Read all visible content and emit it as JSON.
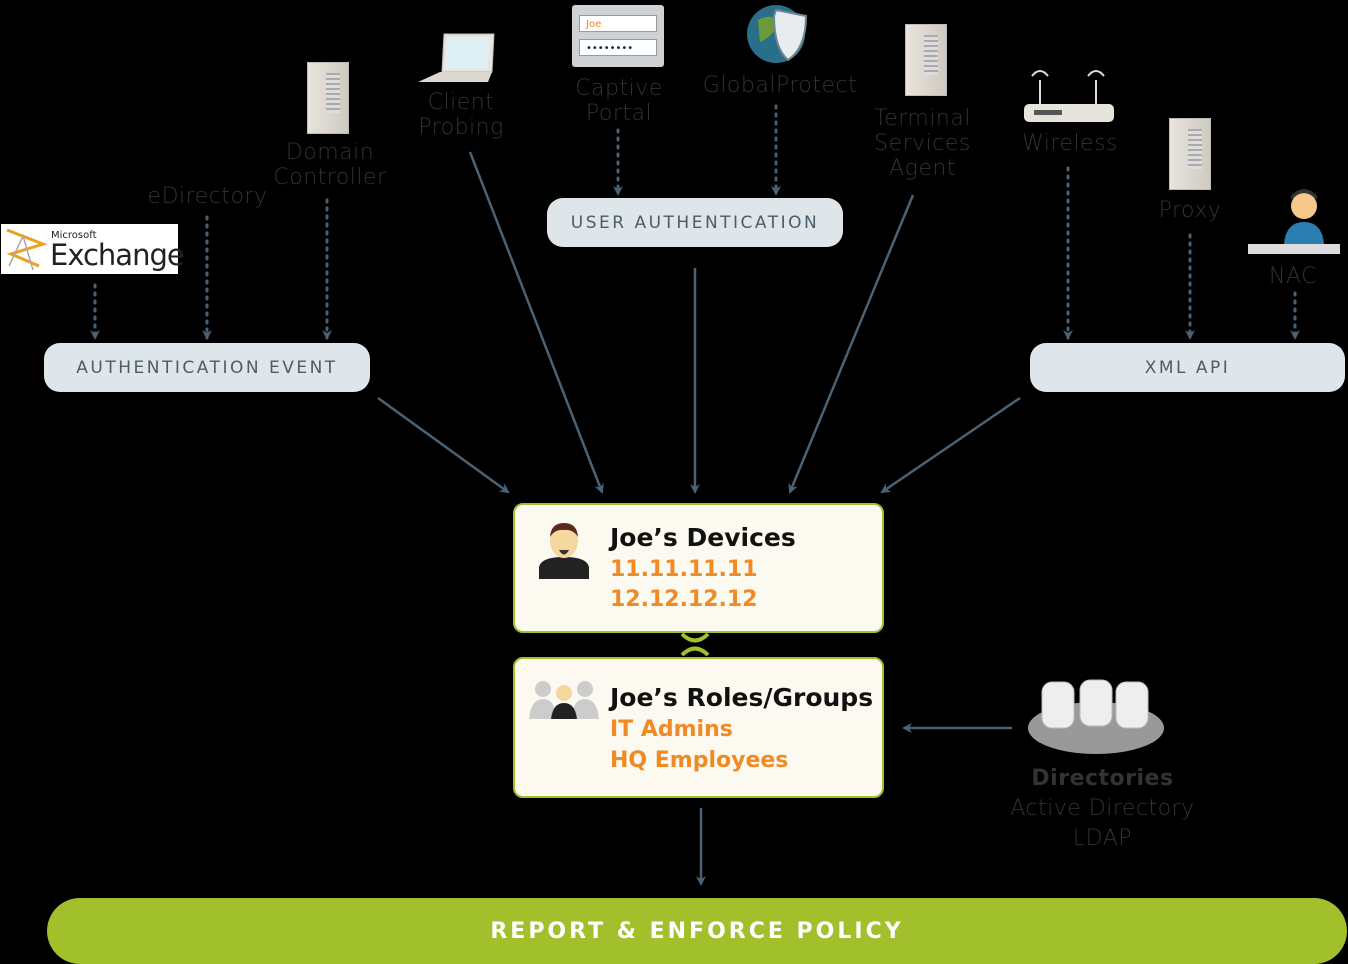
{
  "sources": {
    "exchange": {
      "small": "Microsoft",
      "big": "Exchange"
    },
    "edirectory": "eDirectory",
    "domain_controller": [
      "Domain",
      "Controller"
    ],
    "client_probing": [
      "Client",
      "Probing"
    ],
    "captive_portal": {
      "label": [
        "Captive",
        "Portal"
      ],
      "username": "Joe",
      "password": "••••••••"
    },
    "globalprotect": "GlobalProtect",
    "terminal_services": [
      "Terminal",
      "Services",
      "Agent"
    ],
    "wireless": "Wireless",
    "proxy": "Proxy",
    "nac": "NAC"
  },
  "collectors": {
    "authentication_event": "AUTHENTICATION EVENT",
    "user_authentication": "USER AUTHENTICATION",
    "xml_api": "XML API"
  },
  "devices": {
    "title": "Joe’s Devices",
    "items": [
      "11.11.11.11",
      "12.12.12.12"
    ]
  },
  "roles": {
    "title": "Joe’s Roles/Groups",
    "items": [
      "IT Admins",
      "HQ Employees"
    ]
  },
  "directories": {
    "title": "Directories",
    "items": [
      "Active Directory",
      "LDAP"
    ]
  },
  "policy": "REPORT & ENFORCE POLICY",
  "colors": {
    "accent_green": "#a2c02c",
    "orange": "#f08a24",
    "arrow": "#4a6275",
    "pill": "#dfe6ea"
  }
}
